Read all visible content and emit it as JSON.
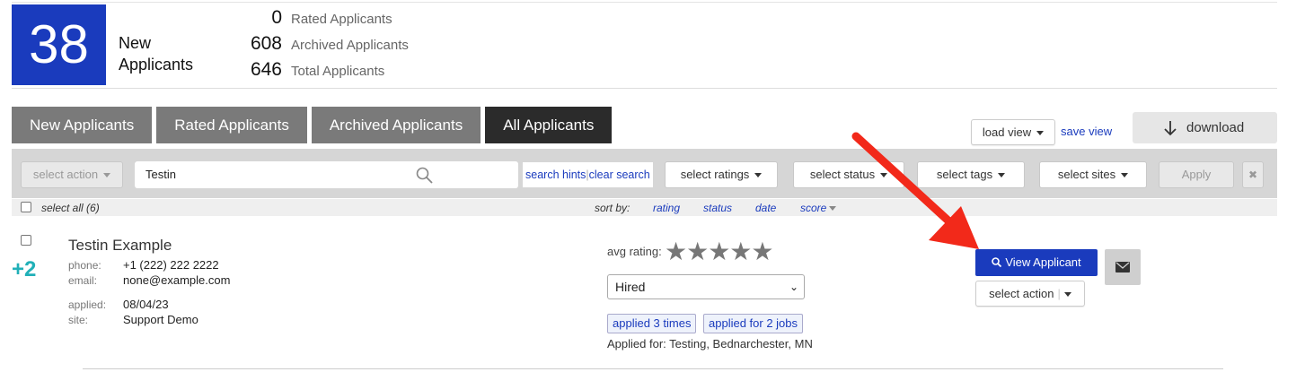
{
  "summary": {
    "new_count": "38",
    "new_label_1": "New",
    "new_label_2": "Applicants",
    "stats": [
      {
        "value": "0",
        "label": "Rated Applicants"
      },
      {
        "value": "608",
        "label": "Archived Applicants"
      },
      {
        "value": "646",
        "label": "Total Applicants"
      }
    ]
  },
  "tabs": [
    {
      "label": "New Applicants",
      "active": false
    },
    {
      "label": "Rated Applicants",
      "active": false
    },
    {
      "label": "Archived Applicants",
      "active": false
    },
    {
      "label": "All Applicants",
      "active": true
    }
  ],
  "view": {
    "load_view": "load view",
    "save_view": "save view",
    "download": "download"
  },
  "filters": {
    "select_action": "select action",
    "search_value": "Testin",
    "search_hints": "search hints",
    "clear_search": "clear search",
    "select_ratings": "select ratings",
    "select_status": "select status",
    "select_tags": "select tags",
    "select_sites": "select sites",
    "apply": "Apply",
    "close": "✖"
  },
  "sortbar": {
    "select_all": "select all (6)",
    "sort_by": "sort by:",
    "options": [
      "rating",
      "status",
      "date",
      "score"
    ]
  },
  "applicant": {
    "badge": "+2",
    "name": "Testin Example",
    "phone_label": "phone:",
    "phone": "+1 (222) 222 2222",
    "email_label": "email:",
    "email": "none@example.com",
    "applied_label": "applied:",
    "applied": "08/04/23",
    "site_label": "site:",
    "site": "Support Demo",
    "avg_rating_label": "avg rating:",
    "stars": "★★★★★",
    "status": "Hired",
    "tags": [
      "applied 3 times",
      "applied for 2 jobs"
    ],
    "applied_for": "Applied for: Testing, Bednarchester, MN",
    "view_button": "View Applicant",
    "select_action": "select action"
  },
  "colors": {
    "accent": "#1a3bbd",
    "tab_active": "#2b2b2b",
    "tab": "#7a7a7a",
    "badge_teal": "#21b0b8",
    "arrow": "#f2291a"
  }
}
